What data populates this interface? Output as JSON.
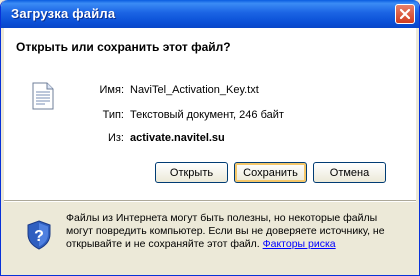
{
  "window": {
    "title": "Загрузка файла",
    "close_icon": "close-icon"
  },
  "dialog": {
    "question": "Открыть или сохранить этот файл?",
    "file_icon": "text-document-icon",
    "name_label": "Имя:",
    "name_value": "NaviTel_Activation_Key.txt",
    "type_label": "Тип:",
    "type_value": "Текстовый документ, 246 байт",
    "from_label": "Из:",
    "from_value": "activate.navitel.su"
  },
  "buttons": {
    "open": "Открыть",
    "save": "Сохранить",
    "cancel": "Отмена"
  },
  "warning": {
    "icon": "shield-question-icon",
    "line1": "Файлы из Интернета могут быть полезны, но некоторые файлы",
    "line2": "могут повредить компьютер. Если вы не доверяете источнику, не",
    "line3": "открывайте и не сохраняйте этот файл.",
    "link": "Факторы риска"
  },
  "colors": {
    "title_bar": "#1b64e4",
    "close_button": "#d13c1f",
    "dialog_face": "#ece9d8",
    "link": "#0000ff"
  }
}
